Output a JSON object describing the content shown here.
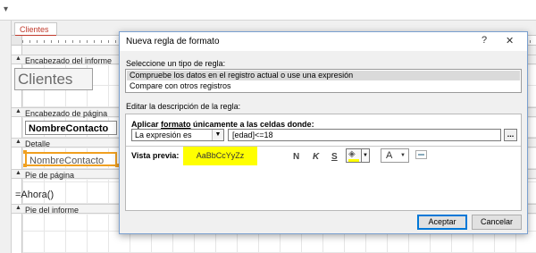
{
  "quick_access": {
    "icon": "dropdown-arrow-icon",
    "glyph": "▾"
  },
  "document": {
    "tab_label": "Clientes"
  },
  "report": {
    "sections": [
      {
        "label": "Encabezado del informe"
      },
      {
        "label": "Encabezado de página"
      },
      {
        "label": "Detalle"
      },
      {
        "label": "Pie de página"
      },
      {
        "label": "Pie del informe"
      }
    ],
    "title_control": "Clientes",
    "header_field": "NombreContacto",
    "detail_field": "NombreContacto",
    "footer_expr": "=Ahora()"
  },
  "dialog": {
    "title": "Nueva regla de formato",
    "help": "?",
    "close": "✕",
    "rule_type_label": "Seleccione un tipo de regla:",
    "rule_types": [
      "Compruebe los datos en el registro actual o use una expresión",
      "Compare con otros registros"
    ],
    "selected_rule_index": 0,
    "edit_label": "Editar la descripción de la regla:",
    "apply_prefix": "Aplicar ",
    "apply_underlined": "formato",
    "apply_suffix": " únicamente a las celdas donde:",
    "condition_select": "La expresión es",
    "expression": "[edad]<=18",
    "ellipsis": "...",
    "preview_label": "Vista previa:",
    "preview_text": "AaBbCcYyZz",
    "bold": "N",
    "italic": "K",
    "underline": "S",
    "font_color_label": "A",
    "fill_color": "#ffff00",
    "ok": "Aceptar",
    "cancel": "Cancelar"
  }
}
